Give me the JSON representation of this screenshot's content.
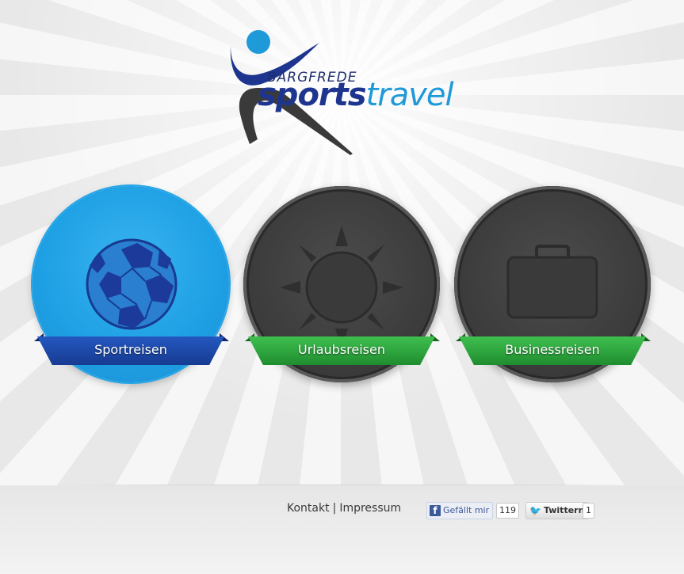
{
  "logo": {
    "top_text": "BARGFREDE",
    "word1": "sports",
    "word2": "travel"
  },
  "categories": [
    {
      "label": "Sportreisen",
      "icon": "soccer-ball-icon",
      "color": "#1fa1e5",
      "ribbon": "#1e46a8"
    },
    {
      "label": "Urlaubsreisen",
      "icon": "sun-icon",
      "color": "#3a3a3a",
      "ribbon": "#2ea23e"
    },
    {
      "label": "Businessreisen",
      "icon": "briefcase-icon",
      "color": "#3a3a3a",
      "ribbon": "#2ea23e"
    }
  ],
  "footer": {
    "kontakt": "Kontakt",
    "separator": "|",
    "impressum": "Impressum",
    "facebook_label": "Gefällt mir",
    "facebook_count": "119",
    "twitter_label": "Twittern",
    "twitter_count": "1"
  }
}
